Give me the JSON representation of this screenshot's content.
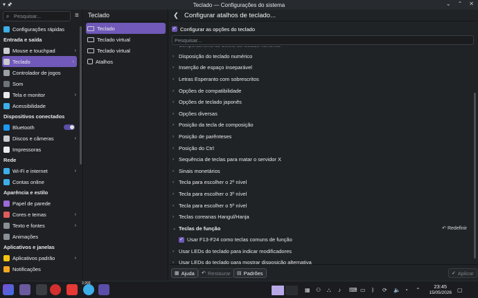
{
  "window": {
    "title": "Teclado — Configurações do sistema",
    "pin_glyph": "▾ 🖈",
    "controls": [
      "⌄",
      "⌃",
      "✕"
    ]
  },
  "sidebar": {
    "search_placeholder": "Pesquisar...",
    "sections": [
      {
        "title": "",
        "items": [
          {
            "label": "Configurações rápidas",
            "icon": "sliders-icon",
            "color": "#3daee9",
            "chev": false
          }
        ]
      },
      {
        "title": "Entrada e saída",
        "items": [
          {
            "label": "Mouse e touchpad",
            "icon": "mouse-icon",
            "color": "#c9ccd0",
            "chev": true
          },
          {
            "label": "Teclado",
            "icon": "keyboard-icon",
            "color": "#c9ccd0",
            "chev": true,
            "active": true
          },
          {
            "label": "Controlador de jogos",
            "icon": "gamepad-icon",
            "color": "#9aa0a6",
            "chev": false
          },
          {
            "label": "Som",
            "icon": "speaker-icon",
            "color": "#6d7379",
            "chev": false
          },
          {
            "label": "Tela e monitor",
            "icon": "monitor-icon",
            "color": "#e8e9ea",
            "chev": true
          },
          {
            "label": "Acessibilidade",
            "icon": "accessibility-icon",
            "color": "#3daee9",
            "chev": false
          }
        ]
      },
      {
        "title": "Dispositivos conectados",
        "items": [
          {
            "label": "Bluetooth",
            "icon": "bluetooth-icon",
            "color": "#1d99f3",
            "chev": false,
            "toggle": true
          },
          {
            "label": "Discos e câmeras",
            "icon": "disk-icon",
            "color": "#c9ccd0",
            "chev": true
          },
          {
            "label": "Impressoras",
            "icon": "printer-icon",
            "color": "#e8e9ea",
            "chev": false
          }
        ]
      },
      {
        "title": "Rede",
        "items": [
          {
            "label": "Wi-Fi e internet",
            "icon": "globe-icon",
            "color": "#3daee9",
            "chev": true
          },
          {
            "label": "Contas online",
            "icon": "accounts-icon",
            "color": "#3daee9",
            "chev": false
          }
        ]
      },
      {
        "title": "Aparência e estilo",
        "items": [
          {
            "label": "Papel de parede",
            "icon": "wallpaper-icon",
            "color": "#9c6ad8",
            "chev": false
          },
          {
            "label": "Cores e temas",
            "icon": "palette-icon",
            "color": "#e05c5c",
            "chev": true
          },
          {
            "label": "Texto e fontes",
            "icon": "font-icon",
            "color": "#8a8f95",
            "chev": true
          },
          {
            "label": "Animações",
            "icon": "animation-icon",
            "color": "#8a8f95",
            "chev": false
          }
        ]
      },
      {
        "title": "Aplicativos e janelas",
        "items": [
          {
            "label": "Aplicativos padrão",
            "icon": "star-icon",
            "color": "#f5c211",
            "chev": true
          },
          {
            "label": "Notificações",
            "icon": "bell-icon",
            "color": "#f5a623",
            "chev": false
          }
        ]
      }
    ]
  },
  "column2": {
    "title": "Teclado",
    "items": [
      "Teclado",
      "Teclado virtual",
      "Teclado virtual",
      "Atalhos"
    ]
  },
  "column3": {
    "title": "Configurar atalhos de teclado...",
    "configure_label": "Configurar as opções do teclado",
    "search_placeholder": "Pesquisar...",
    "cut_label": "Comportamento do Delete do teclado numérico",
    "options": [
      {
        "label": "Disposição do teclado numérico"
      },
      {
        "label": "Inserção de espaço inseparável"
      },
      {
        "label": "Letras Esperanto com sobrescritos"
      },
      {
        "label": "Opções de compatibilidade"
      },
      {
        "label": "Opções de teclado japonês"
      },
      {
        "label": "Opções diversas"
      },
      {
        "label": "Posição da tecla de composição"
      },
      {
        "label": "Posição de parênteses"
      },
      {
        "label": "Posição do Ctrl"
      },
      {
        "label": "Sequência de teclas para matar o servidor X"
      },
      {
        "label": "Sinais monetários"
      },
      {
        "label": "Tecla para escolher o 2º nível"
      },
      {
        "label": "Tecla para escolher o 3º nível"
      },
      {
        "label": "Tecla para escolher o 5º nível"
      },
      {
        "label": "Teclas coreanas Hangul/Hanja"
      },
      {
        "label": "Teclas de função",
        "expanded": true,
        "reset": "Redefinir"
      },
      {
        "label": "Usar F13-F24 como teclas comuns de função",
        "child": true
      },
      {
        "label": "Usar LEDs do teclado para indicar modificadores"
      },
      {
        "label": "Usar LEDs do teclado para mostrar disposição alternativa"
      }
    ],
    "footer": {
      "help": "Ajuda",
      "restore": "Restaurar",
      "defaults": "Padrões",
      "apply": "Aplicar"
    }
  },
  "taskbar": {
    "badge_count": "3,999",
    "time": "23:45",
    "date": "15/05/2026"
  }
}
